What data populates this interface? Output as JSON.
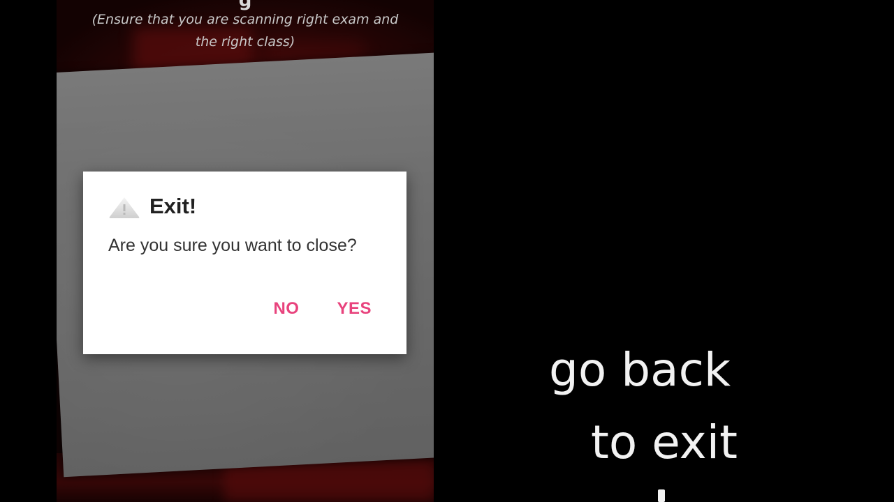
{
  "screen": {
    "top_title_fragment": "g",
    "hint": "(Ensure that you are scanning right exam and the right class)",
    "bottom_fragment": "..."
  },
  "dialog": {
    "icon": "warning-triangle-icon",
    "title": "Exit!",
    "message": "Are you sure you want to close?",
    "buttons": {
      "no": "NO",
      "yes": "YES"
    },
    "accent_color": "#e8437d"
  },
  "caption": {
    "line1": "go back",
    "line2": "to exit"
  }
}
